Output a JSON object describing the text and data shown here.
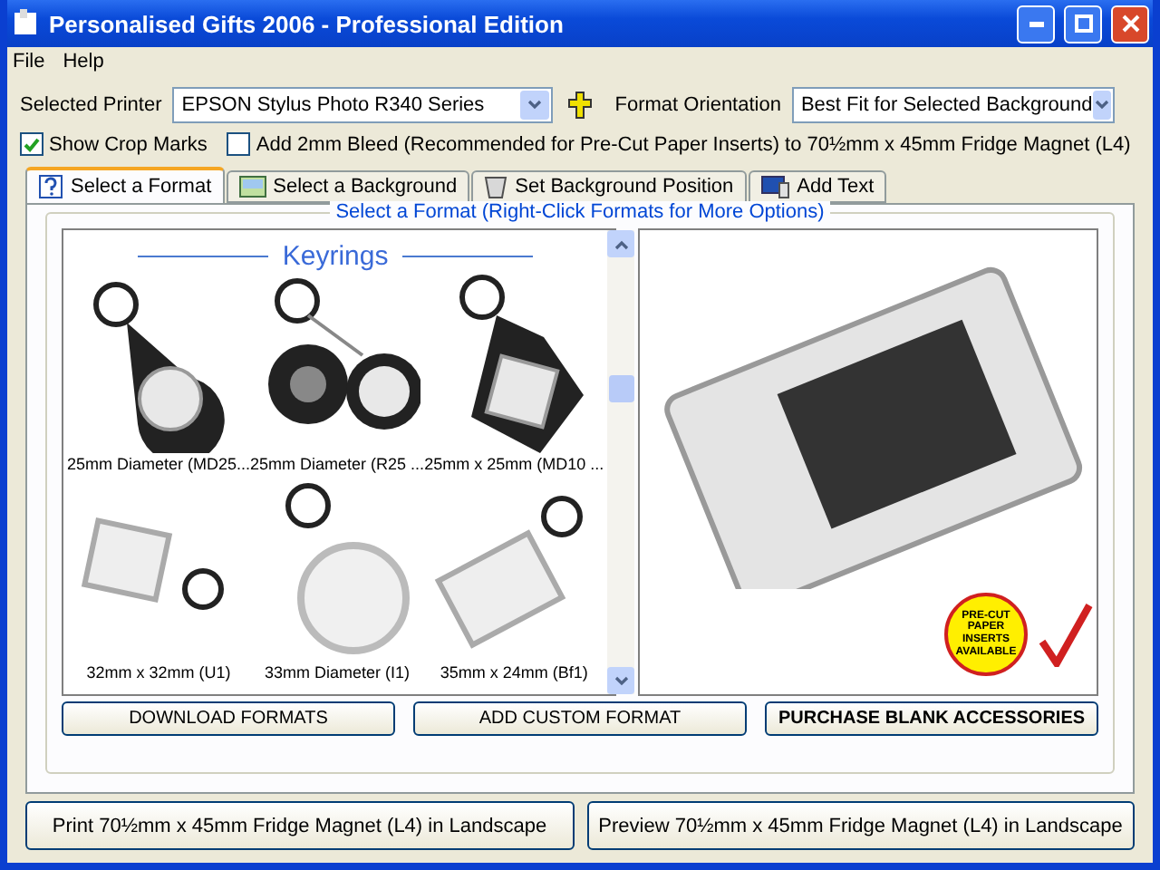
{
  "window": {
    "title": "Personalised Gifts 2006 - Professional Edition"
  },
  "menu": [
    "File",
    "Help"
  ],
  "printer": {
    "label": "Selected Printer",
    "value": "EPSON Stylus Photo R340 Series"
  },
  "orientation": {
    "label": "Format Orientation",
    "value": "Best Fit for Selected Background"
  },
  "options": [
    {
      "label": "Show Crop Marks",
      "checked": true
    },
    {
      "label": "Add 2mm Bleed (Recommended for Pre-Cut Paper Inserts) to 70½mm x 45mm Fridge Magnet (L4)",
      "checked": false
    }
  ],
  "tabs": [
    {
      "label": "Select a Format",
      "selected": true,
      "kind": "help"
    },
    {
      "label": "Select a Background",
      "selected": false,
      "kind": "picture"
    },
    {
      "label": "Set Background Position",
      "selected": false,
      "kind": "bin"
    },
    {
      "label": "Add Text",
      "selected": false,
      "kind": "monitor"
    }
  ],
  "group_title": "Select a Format (Right-Click Formats for More Options)",
  "format_list": {
    "heading": "Keyrings",
    "items": [
      {
        "label": "25mm Diameter (MD25...",
        "kind": "leather-round"
      },
      {
        "label": "25mm Diameter (R25 ...",
        "kind": "tyre"
      },
      {
        "label": "25mm x 25mm (MD10 ...",
        "kind": "leather-square"
      },
      {
        "label": "32mm x 32mm (U1)",
        "kind": "clear-square"
      },
      {
        "label": "33mm Diameter (I1)",
        "kind": "clear-round"
      },
      {
        "label": "35mm x 24mm (Bf1)",
        "kind": "clear-rect"
      }
    ]
  },
  "preview": {
    "badge": "PRE-CUT PAPER INSERTS AVAILABLE"
  },
  "format_buttons": [
    {
      "label": "DOWNLOAD FORMATS",
      "bold": false
    },
    {
      "label": "ADD CUSTOM FORMAT",
      "bold": false
    },
    {
      "label": "PURCHASE BLANK ACCESSORIES",
      "bold": true
    }
  ],
  "actions": [
    "Print 70½mm x 45mm Fridge Magnet (L4) in Landscape",
    "Preview 70½mm x 45mm Fridge Magnet (L4) in Landscape"
  ]
}
